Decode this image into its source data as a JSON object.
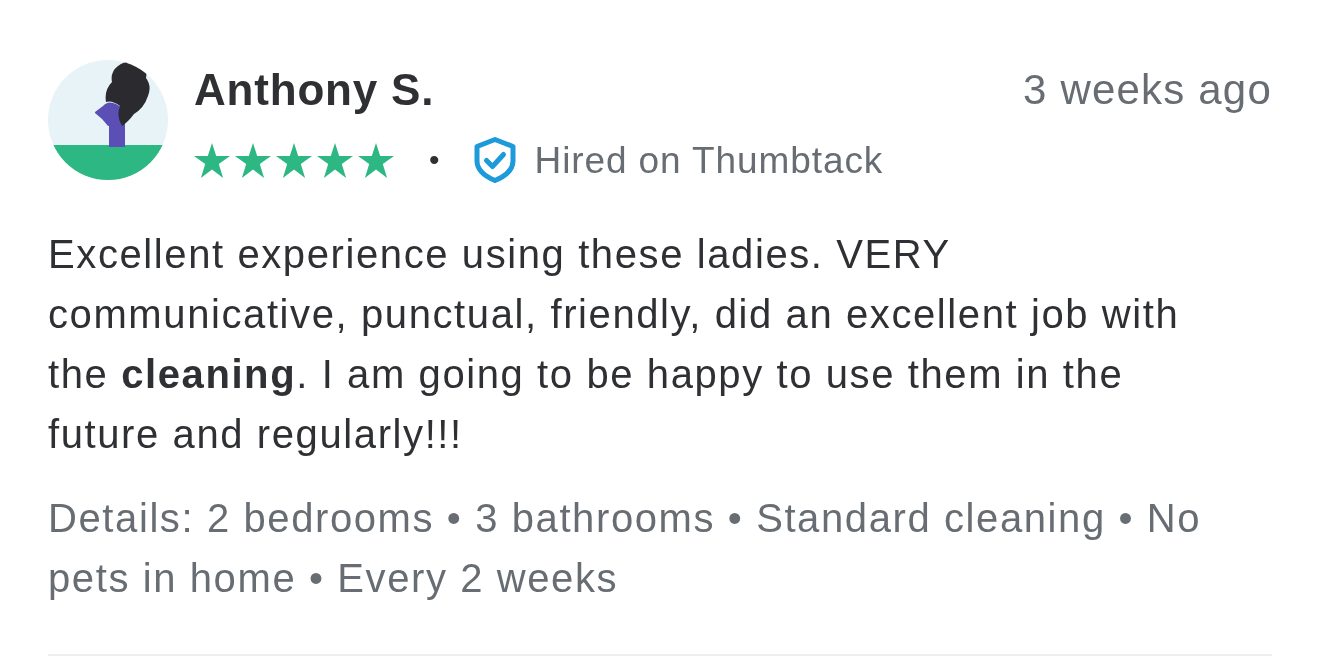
{
  "review": {
    "author": "Anthony S.",
    "time": "3 weeks ago",
    "stars": 5,
    "separator": "•",
    "badge": "Hired on Thumbtack",
    "body": "Excellent experience using these ladies. VERY communicative, punctual, friendly, did an excellent job with the **cleaning**. I am going to be happy to use them in the future and regularly!!!",
    "details": "Details: 2 bedrooms • 3 bathrooms • Standard cleaning • No pets in home • Every 2 weeks"
  }
}
